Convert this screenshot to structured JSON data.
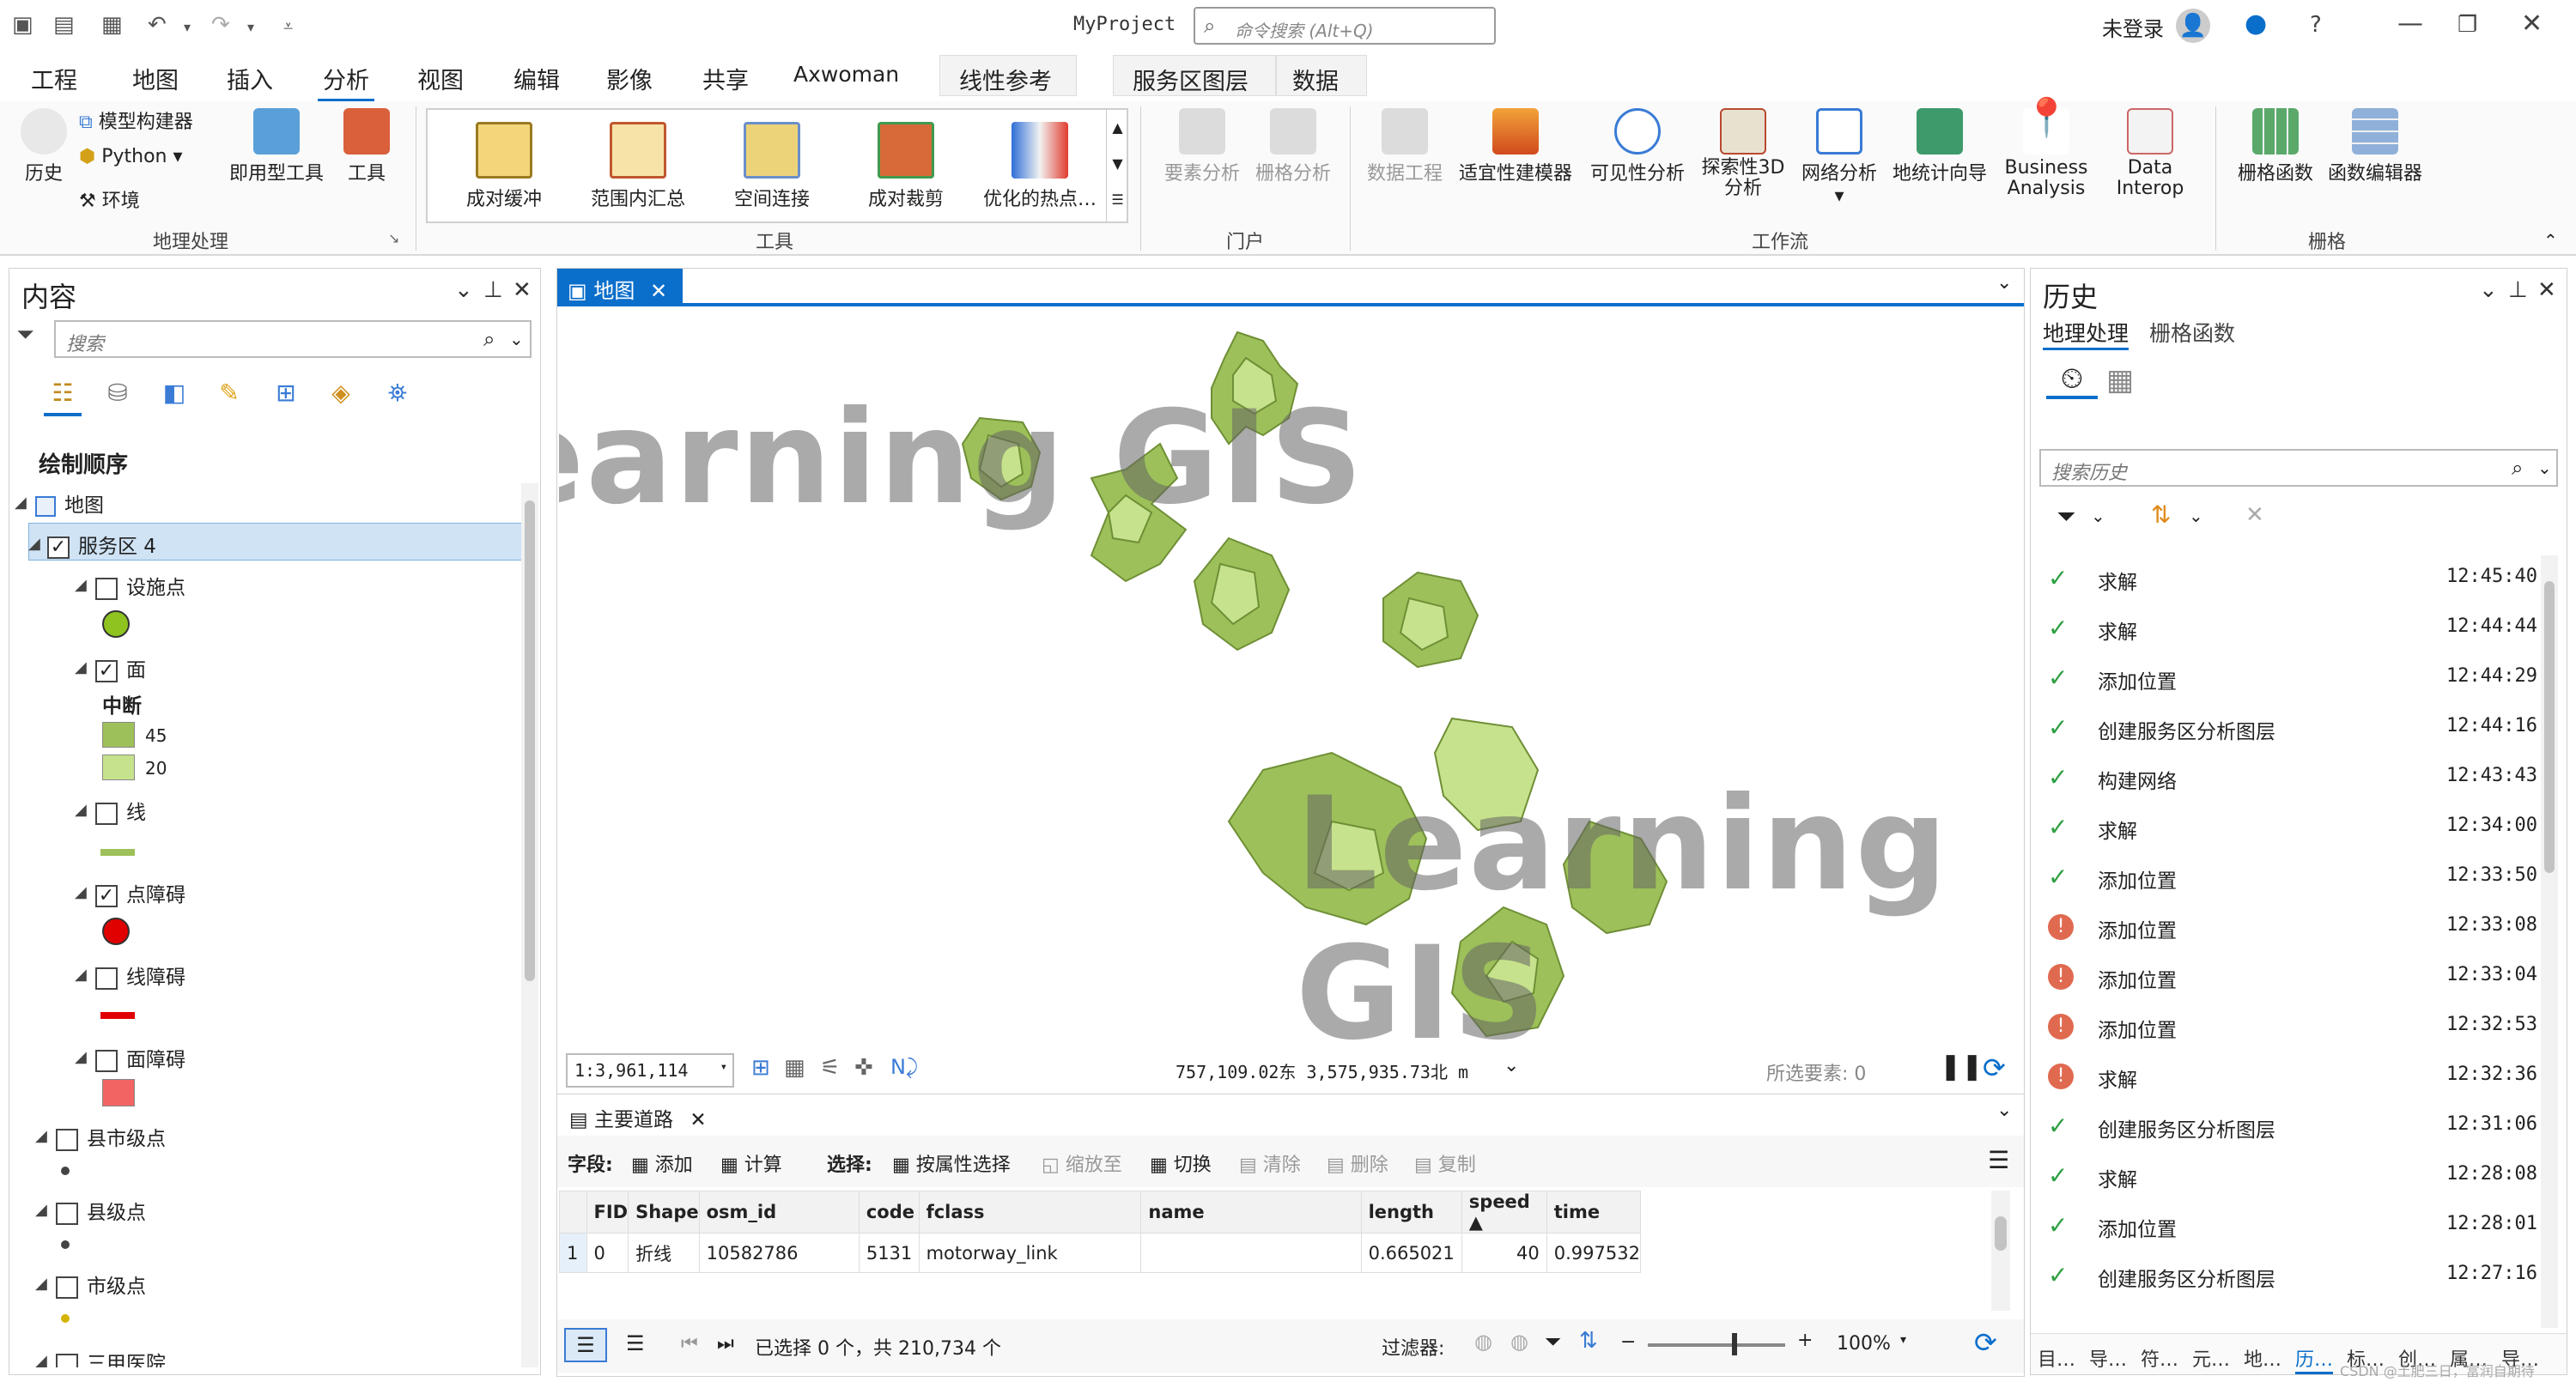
{
  "titlebar": {
    "project": "MyProject",
    "command_placeholder": "命令搜索 (Alt+Q)",
    "user": "未登录"
  },
  "menu": {
    "tabs": [
      "工程",
      "地图",
      "插入",
      "分析",
      "视图",
      "编辑",
      "影像",
      "共享",
      "Axwoman"
    ],
    "context_tabs": [
      "线性参考",
      "服务区图层",
      "数据"
    ]
  },
  "ribbon": {
    "geoprocessing": {
      "history": "历史",
      "model_builder": "模型构建器",
      "python": "Python",
      "environments": "环境",
      "ready_tools": "即用型工具",
      "tools": "工具",
      "group": "地理处理"
    },
    "tools_gallery": {
      "items": [
        "成对缓冲",
        "范围内汇总",
        "空间连接",
        "成对裁剪",
        "优化的热点…"
      ],
      "group": "工具"
    },
    "portal": {
      "feature_analysis": "要素分析",
      "raster_analysis": "栅格分析",
      "group": "门户"
    },
    "workflows": {
      "items": [
        "数据工程",
        "适宜性建模器",
        "可见性分析",
        "探索性3D 分析",
        "网络分析",
        "地统计向导",
        "Business Analysis",
        "Data Interop"
      ],
      "group": "工作流"
    },
    "raster": {
      "raster_functions": "栅格函数",
      "function_editor": "函数编辑器",
      "group": "栅格"
    }
  },
  "contents": {
    "title": "内容",
    "search_placeholder": "搜索",
    "drawing_order": "绘制顺序",
    "map": "地图",
    "service_area": "服务区 4",
    "facilities": "设施点",
    "polygons": "面",
    "break_label": "中断",
    "break1": "45",
    "break2": "20",
    "lines": "线",
    "point_barriers": "点障碍",
    "line_barriers": "线障碍",
    "polygon_barriers": "面障碍",
    "county_city_pts": "县市级点",
    "county_pts": "县级点",
    "city_pts": "市级点",
    "hospital": "三甲医院"
  },
  "colors": {
    "accent": "#0a6ecb",
    "poly_dark": "#9dc05a",
    "poly_light": "#c6e28c",
    "facility": "#8fc31f",
    "barrier": "#e00000",
    "poly_barrier": "#f26464"
  },
  "map": {
    "tab": "地图",
    "watermark": "Learning GIS",
    "scale": "1:3,961,114",
    "coords": "757,109.02东  3,575,935.73北 m",
    "selected": "所选要素: 0"
  },
  "attr": {
    "tab": "主要道路",
    "fields_label": "字段:",
    "add": "添加",
    "calc": "计算",
    "select_label": "选择:",
    "by_attr": "按属性选择",
    "zoom": "缩放至",
    "switch": "切换",
    "clear": "清除",
    "delete": "删除",
    "copy": "复制",
    "columns": [
      "FID",
      "Shape",
      "osm_id",
      "code",
      "fclass",
      "name",
      "length",
      "speed",
      "time"
    ],
    "row": [
      "0",
      "折线",
      "10582786",
      "5131",
      "motorway_link",
      "",
      "0.665021",
      "40",
      "0.997532"
    ],
    "row_num": "1",
    "status": "已选择 0 个，共 210,734 个",
    "filter": "过滤器:",
    "zoom_pct": "100%"
  },
  "history": {
    "title": "历史",
    "tab1": "地理处理",
    "tab2": "栅格函数",
    "search_placeholder": "搜索历史",
    "items": [
      {
        "name": "求解",
        "time": "12:45:40",
        "ok": true
      },
      {
        "name": "求解",
        "time": "12:44:44",
        "ok": true
      },
      {
        "name": "添加位置",
        "time": "12:44:29",
        "ok": true
      },
      {
        "name": "创建服务区分析图层",
        "time": "12:44:16",
        "ok": true
      },
      {
        "name": "构建网络",
        "time": "12:43:43",
        "ok": true
      },
      {
        "name": "求解",
        "time": "12:34:00",
        "ok": true
      },
      {
        "name": "添加位置",
        "time": "12:33:50",
        "ok": true
      },
      {
        "name": "添加位置",
        "time": "12:33:08",
        "ok": false
      },
      {
        "name": "添加位置",
        "time": "12:33:04",
        "ok": false
      },
      {
        "name": "添加位置",
        "time": "12:32:53",
        "ok": false
      },
      {
        "name": "求解",
        "time": "12:32:36",
        "ok": false
      },
      {
        "name": "创建服务区分析图层",
        "time": "12:31:06",
        "ok": true
      },
      {
        "name": "求解",
        "time": "12:28:08",
        "ok": true
      },
      {
        "name": "添加位置",
        "time": "12:28:01",
        "ok": true
      },
      {
        "name": "创建服务区分析图层",
        "time": "12:27:16",
        "ok": true
      }
    ],
    "bottom_tabs": [
      "目…",
      "导…",
      "符…",
      "元…",
      "地…",
      "历…",
      "标…",
      "创…",
      "属…",
      "导…"
    ],
    "credit": "CSDN @土肥三日，富润自期待"
  }
}
